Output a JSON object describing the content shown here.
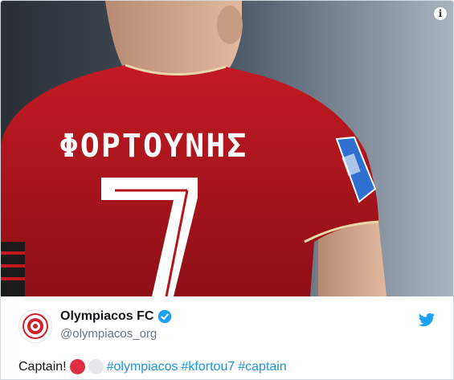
{
  "media": {
    "jersey_name": "ΦΟΡΤΟΥΝΗΣ",
    "jersey_number": "7",
    "info_label": "i"
  },
  "tweet": {
    "display_name": "Olympiacos FC",
    "handle": "@olympiacos_org",
    "text_lead": "Captain!",
    "hashtags": [
      "#olympiacos",
      "#kfortou7",
      "#captain"
    ],
    "emojis": [
      "red-circle",
      "white-circle"
    ]
  },
  "colors": {
    "hashtag": "#1b95e0",
    "twitter_blue": "#1da1f2",
    "jersey_red": "#b3141e"
  },
  "icons": [
    "info-icon",
    "verified-badge-icon",
    "twitter-bird-icon",
    "olympiacos-crest-icon"
  ]
}
